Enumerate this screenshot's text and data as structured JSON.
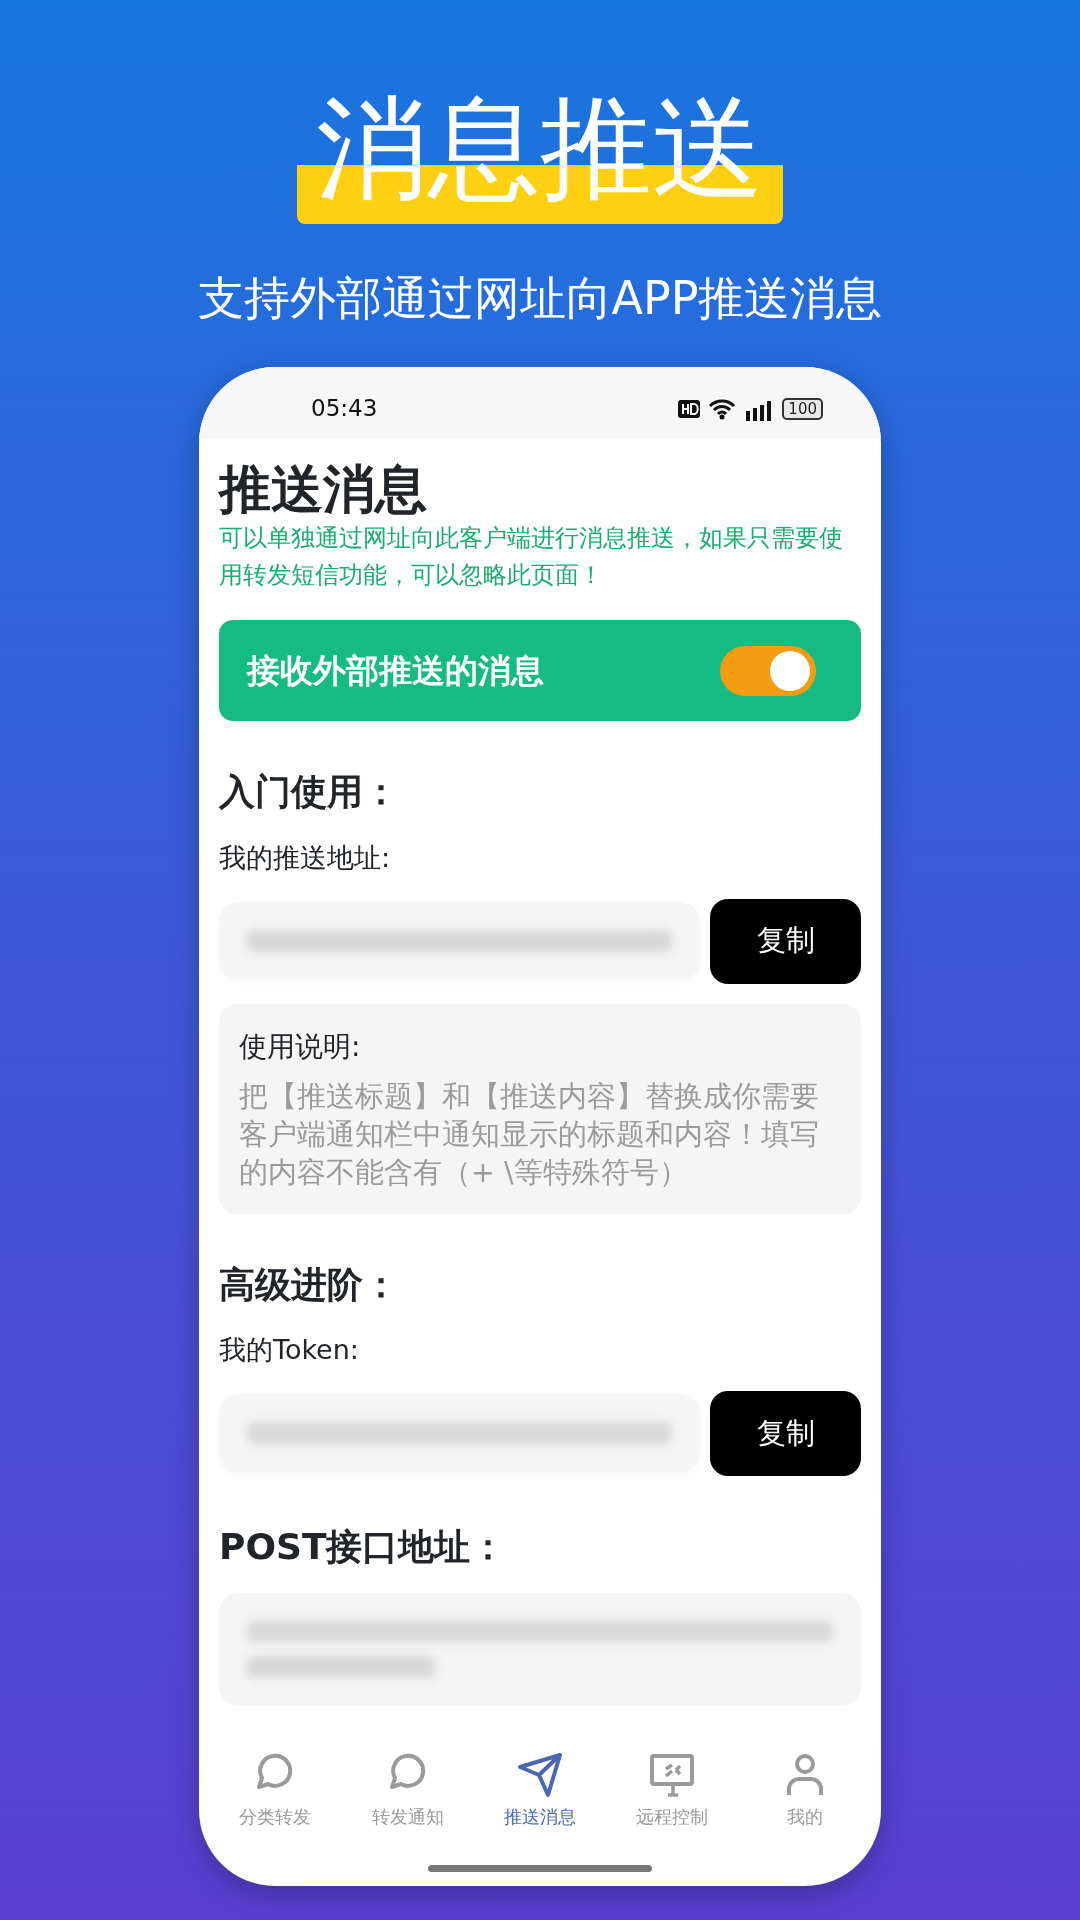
{
  "headline": "消息推送",
  "subtitle": "支持外部通过网址向APP推送消息",
  "status_bar": {
    "time": "05:43",
    "battery": "100"
  },
  "page": {
    "title": "推送消息",
    "notice": "可以单独通过网址向此客户端进行消息推送，如果只需要使用转发短信功能，可以忽略此页面！"
  },
  "receive_toggle": {
    "label": "接收外部推送的消息",
    "on": true
  },
  "sections": [
    {
      "heading": "入门使用：",
      "field_label": "我的推送地址:",
      "copy_button": "复制",
      "help": {
        "title": "使用说明:",
        "text": "把【推送标题】和【推送内容】替换成你需要客户端通知栏中通知显示的标题和内容！填写的内容不能含有（+ \\等特殊符号）"
      }
    },
    {
      "heading": "高级进阶：",
      "field_label": "我的Token:",
      "copy_button": "复制"
    },
    {
      "heading": "POST接口地址："
    }
  ],
  "bottom_nav": [
    {
      "label": "分类转发",
      "kind": "chat",
      "selected": false
    },
    {
      "label": "转发通知",
      "kind": "chat",
      "selected": false
    },
    {
      "label": "推送消息",
      "kind": "send",
      "selected": true
    },
    {
      "label": "远程控制",
      "kind": "monitor",
      "selected": false
    },
    {
      "label": "我的",
      "kind": "person",
      "selected": false
    }
  ]
}
